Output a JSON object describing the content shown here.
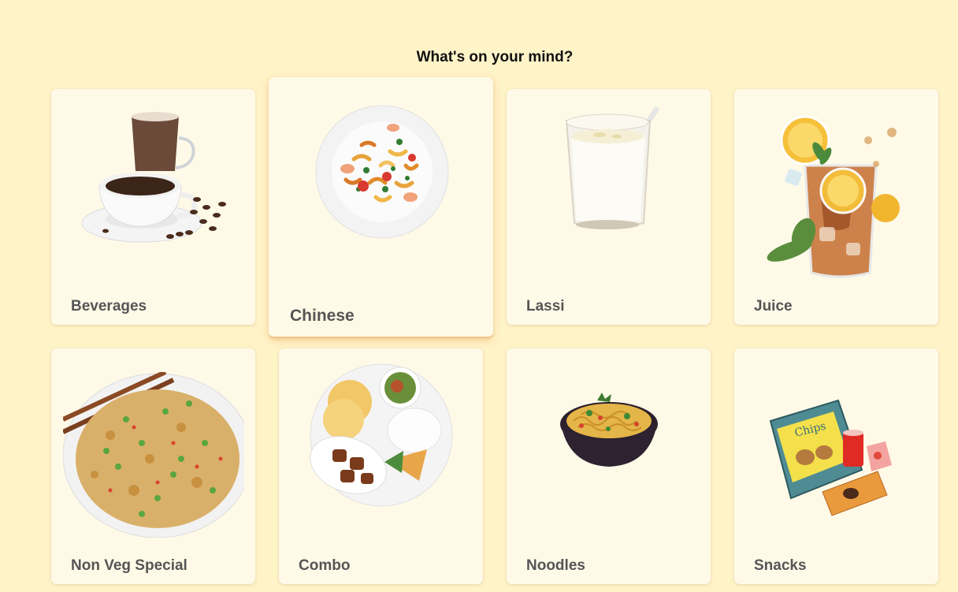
{
  "heading": "What's on your mind?",
  "categories": [
    {
      "label": "Beverages",
      "icon": "coffee-cups-image"
    },
    {
      "label": "Chinese",
      "icon": "pasta-plate-image"
    },
    {
      "label": "Lassi",
      "icon": "lassi-glass-image"
    },
    {
      "label": "Juice",
      "icon": "iced-tea-juice-image"
    },
    {
      "label": "Non Veg Special",
      "icon": "fried-rice-image"
    },
    {
      "label": "Combo",
      "icon": "combo-thali-image"
    },
    {
      "label": "Noodles",
      "icon": "noodle-bowl-image"
    },
    {
      "label": "Snacks",
      "icon": "chips-snacks-image"
    }
  ],
  "colors": {
    "background": "#fff3c8",
    "card": "#fffae8",
    "label": "#555555"
  }
}
